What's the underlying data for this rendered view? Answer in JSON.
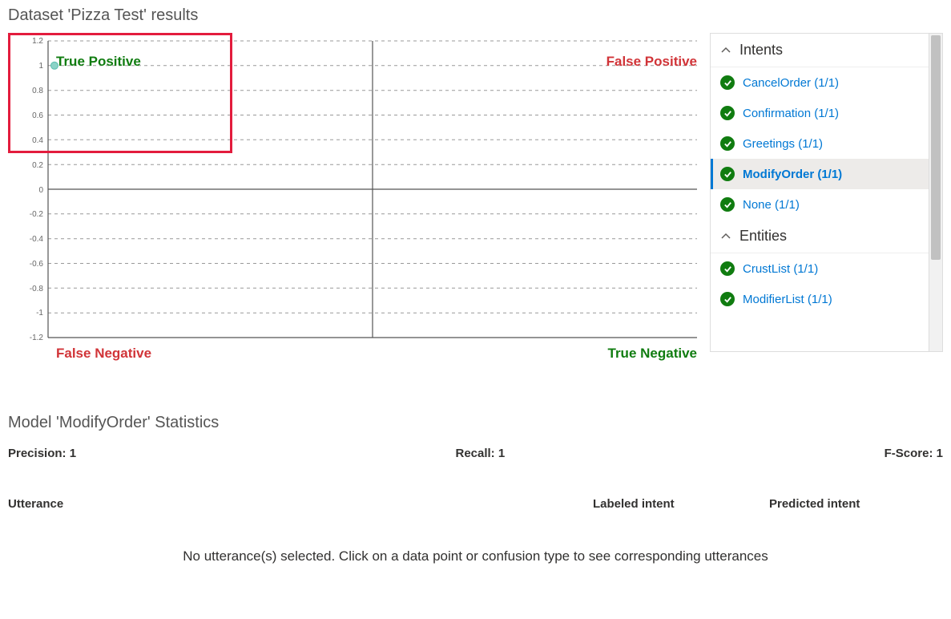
{
  "header": {
    "title": "Dataset 'Pizza Test' results"
  },
  "chart": {
    "quad_tp": "True Positive",
    "quad_fp": "False Positive",
    "quad_fn": "False Negative",
    "quad_tn": "True Negative"
  },
  "chart_data": {
    "type": "scatter",
    "title": "",
    "xlabel": "",
    "ylabel": "",
    "xlim": [
      0,
      1
    ],
    "ylim": [
      -1.2,
      1.2
    ],
    "y_ticks": [
      -1.2,
      -1,
      -0.8,
      -0.6,
      -0.4,
      -0.2,
      0,
      0.2,
      0.4,
      0.6,
      0.8,
      1,
      1.2
    ],
    "series": [
      {
        "name": "ModifyOrder",
        "points": [
          {
            "x": 0.02,
            "y": 1.0
          }
        ]
      }
    ],
    "quadrants": {
      "top_left": "True Positive",
      "top_right": "False Positive",
      "bottom_left": "False Negative",
      "bottom_right": "True Negative"
    }
  },
  "panel": {
    "intents_header": "Intents",
    "entities_header": "Entities",
    "intents": [
      {
        "label": "CancelOrder (1/1)",
        "selected": false
      },
      {
        "label": "Confirmation (1/1)",
        "selected": false
      },
      {
        "label": "Greetings (1/1)",
        "selected": false
      },
      {
        "label": "ModifyOrder (1/1)",
        "selected": true
      },
      {
        "label": "None (1/1)",
        "selected": false
      }
    ],
    "entities": [
      {
        "label": "CrustList (1/1)",
        "selected": false
      },
      {
        "label": "ModifierList (1/1)",
        "selected": false
      }
    ]
  },
  "stats": {
    "title": "Model 'ModifyOrder' Statistics",
    "precision_label": "Precision: 1",
    "recall_label": "Recall: 1",
    "fscore_label": "F-Score: 1"
  },
  "table": {
    "col_utterance": "Utterance",
    "col_labeled": "Labeled intent",
    "col_predicted": "Predicted intent",
    "empty": "No utterance(s) selected. Click on a data point or confusion type to see corresponding utterances"
  }
}
